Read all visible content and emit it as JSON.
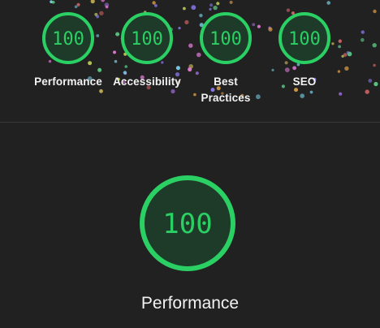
{
  "colors": {
    "background": "#212121",
    "pass_green": "#0cce6b",
    "gauge_fill": "#1e3a28",
    "text": "#f2f2f2"
  },
  "summary": {
    "gauges": [
      {
        "score": "100",
        "label": "Performance"
      },
      {
        "score": "100",
        "label": "Accessibility"
      },
      {
        "score": "100",
        "label": "Best Practices"
      },
      {
        "score": "100",
        "label": "SEO"
      }
    ]
  },
  "category": {
    "score": "100",
    "title": "Performance"
  }
}
